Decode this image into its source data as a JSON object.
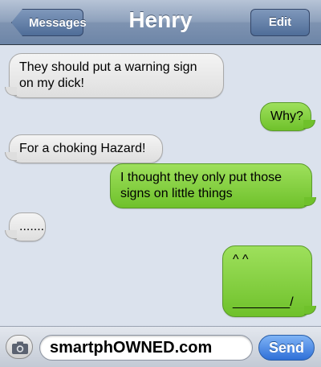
{
  "header": {
    "title": "Henry",
    "back_label": "Messages",
    "edit_label": "Edit"
  },
  "messages": [
    {
      "side": "received",
      "text": "They should put a warning sign on my dick!"
    },
    {
      "side": "sent",
      "text": "Why?"
    },
    {
      "side": "received",
      "text": "For a choking Hazard!"
    },
    {
      "side": "sent",
      "text": "I thought they only put those signs on little things"
    },
    {
      "side": "received",
      "text": "......."
    },
    {
      "side": "sent",
      "line1": "^ ^",
      "line2": "________/"
    }
  ],
  "composer": {
    "input_value": "smartphOWNED.com",
    "send_label": "Send",
    "camera_icon": "camera-icon"
  },
  "colors": {
    "sent_bubble": "#7fcd3a",
    "received_bubble": "#e8e8e8",
    "nav_bar": "#7e93b1",
    "send_button": "#3f7fe0"
  }
}
